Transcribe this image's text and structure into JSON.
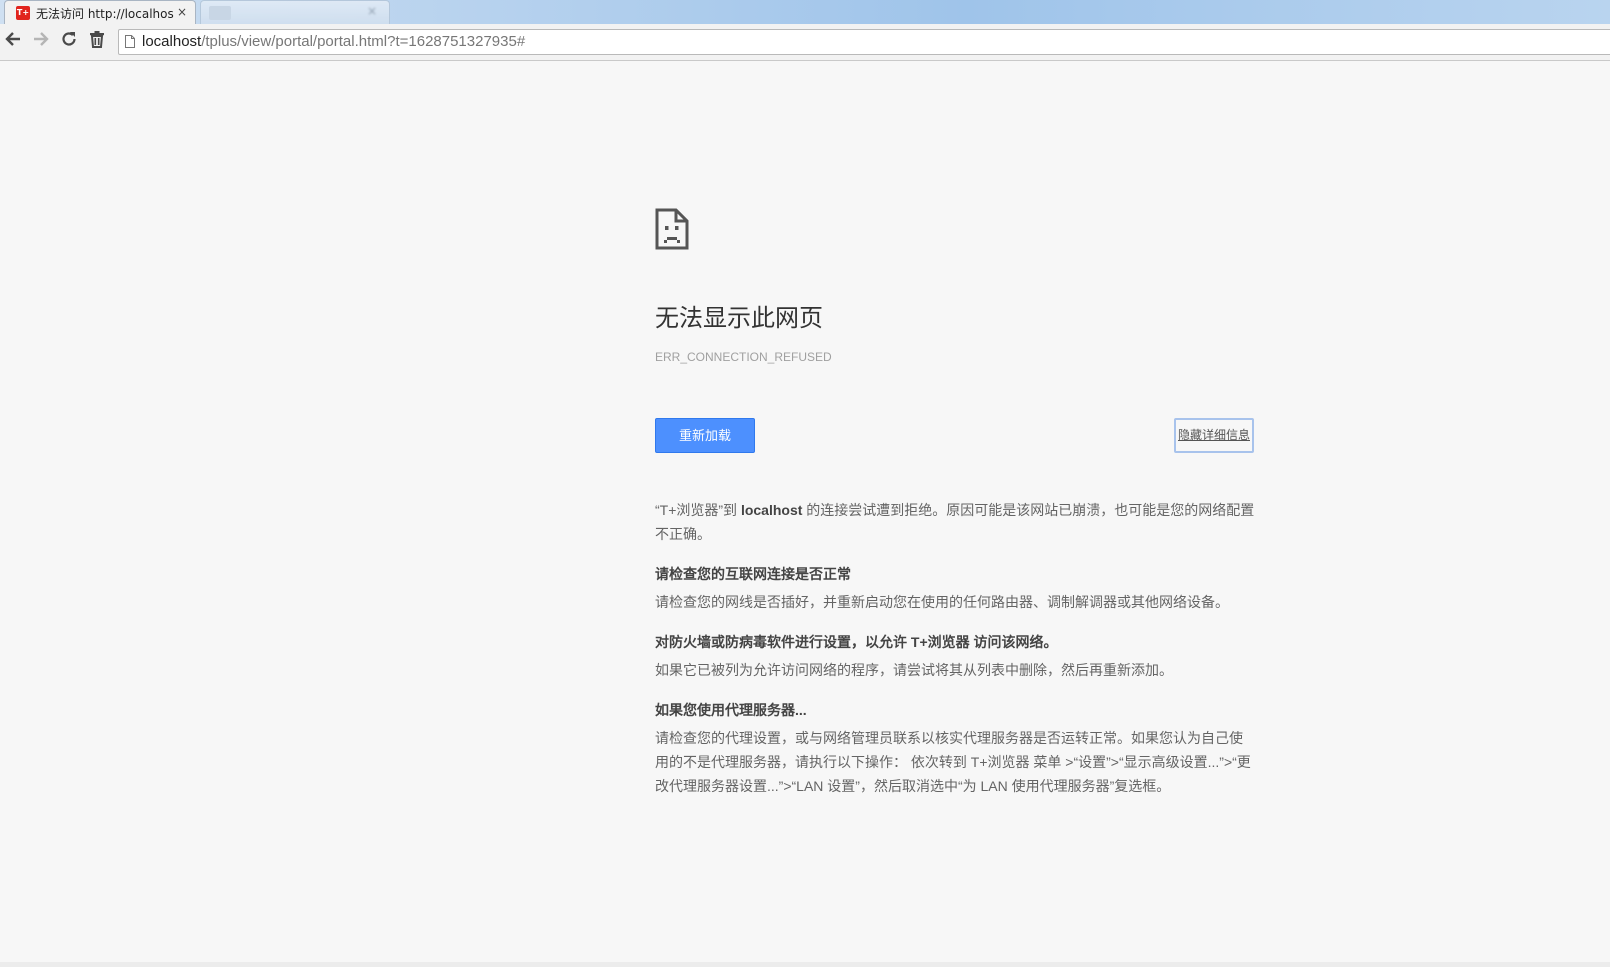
{
  "browser": {
    "active_tab": {
      "title": "无法访问 http://localhost",
      "favicon_text": "T+",
      "close_glyph": "×"
    },
    "inactive_tab": {
      "title": "",
      "close_glyph": "×"
    },
    "toolbar": {
      "back_icon": "back-arrow-icon",
      "forward_icon": "forward-arrow-icon",
      "reload_icon": "reload-icon",
      "clear_icon": "trash-icon"
    },
    "address": {
      "host": "localhost",
      "path": "/tplus/view/portal/portal.html?t=1628751327935#"
    }
  },
  "error_page": {
    "title": "无法显示此网页",
    "code": "ERR_CONNECTION_REFUSED",
    "reload_label": "重新加载",
    "details_label": "隐藏详细信息",
    "intro": {
      "pre": "“T+浏览器”到 ",
      "host": "localhost",
      "post": " 的连接尝试遭到拒绝。原因可能是该网站已崩溃，也可能是您的网络配置不正确。"
    },
    "sections": [
      {
        "heading": "请检查您的互联网连接是否正常",
        "body": "请检查您的网线是否插好，并重新启动您在使用的任何路由器、调制解调器或其他网络设备。"
      },
      {
        "heading": "对防火墙或防病毒软件进行设置，以允许 T+浏览器 访问该网络。",
        "body": "如果它已被列为允许访问网络的程序，请尝试将其从列表中删除，然后再重新添加。"
      },
      {
        "heading": "如果您使用代理服务器...",
        "body": "请检查您的代理设置，或与网络管理员联系以核实代理服务器是否运转正常。如果您认为自己使用的不是代理服务器，请执行以下操作： 依次转到 T+浏览器 菜单 >“设置”>“显示高级设置...”>“更改代理服务器设置...”>“LAN 设置”，然后取消选中“为 LAN 使用代理服务器”复选框。"
      }
    ]
  },
  "colors": {
    "page_background": "#f7f7f7",
    "reload_button": "#4d90fe",
    "favicon": "#e1241d"
  }
}
